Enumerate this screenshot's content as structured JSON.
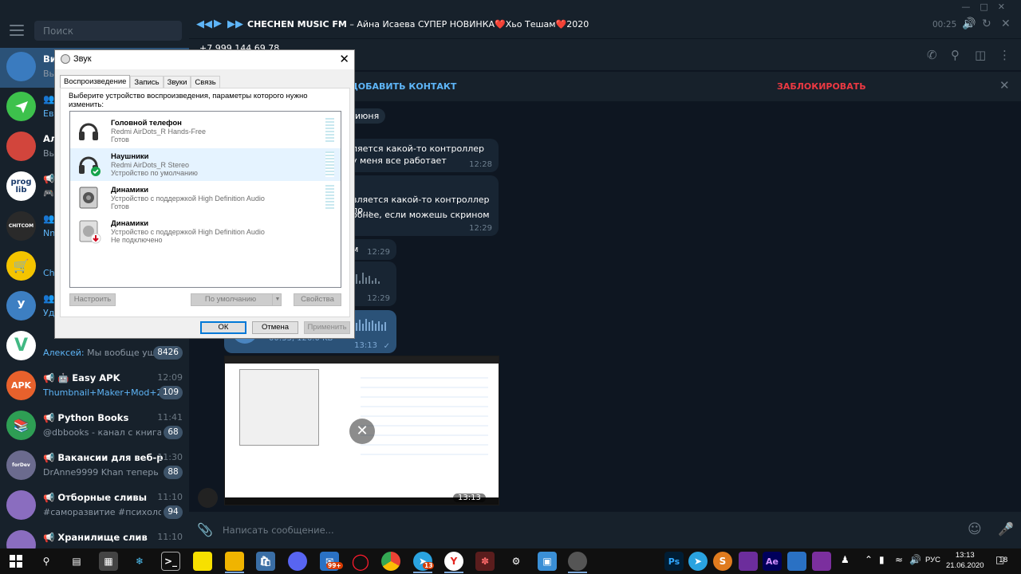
{
  "telegram": {
    "search_placeholder": "Поиск",
    "chats": [
      {
        "title": "Ви",
        "preview": "Вы",
        "avatar_color": "#3a7bbf",
        "avatar_text": ""
      },
      {
        "title": "",
        "preview": "Евг",
        "avatar_color": "#3dc14c",
        "avatar_text": ""
      },
      {
        "title": "Ал",
        "preview": "Вы",
        "avatar_color": "#d2453c",
        "avatar_text": ""
      },
      {
        "title": "",
        "preview": "",
        "avatar_color": "#ffffff",
        "avatar_text": "prog lib"
      },
      {
        "title": "",
        "preview": "Nn",
        "avatar_color": "#2a2a2a",
        "avatar_text": "CHITCOM"
      },
      {
        "title": "",
        "preview": "Cha",
        "avatar_color": "#f4c400",
        "avatar_text": ""
      },
      {
        "title": "Уд",
        "preview": "Уд",
        "avatar_color": "#3d7fc2",
        "avatar_text": "У"
      },
      {
        "title": "",
        "preview_author": "Алексей:",
        "preview": " Мы вообще ушл...",
        "badge": "8426",
        "avatar_color": "#ffffff",
        "avatar_text": "V"
      },
      {
        "title": "Easy APK",
        "time": "12:09",
        "preview": "Thumbnail+Maker+Mod+2.2-...",
        "badge": "109",
        "avatar_color": "#e8612c",
        "avatar_text": "APK"
      },
      {
        "title": "Python Books",
        "time": "11:41",
        "preview": "@dbbooks - канал с книгами ...",
        "badge": "68",
        "avatar_color": "#2e9e54",
        "avatar_text": ""
      },
      {
        "title": "Вакансии для веб-раз...",
        "time": "11:30",
        "preview": "DrAnne9999 Khan теперь в г...",
        "badge": "88",
        "avatar_color": "#6b6b8e",
        "avatar_text": "forDev"
      },
      {
        "title": "Отборные сливы",
        "time": "11:10",
        "preview": "#саморазвитие #психология...",
        "badge": "94",
        "avatar_color": "#8a6dbf",
        "avatar_text": ""
      },
      {
        "title": "Хранилище слив",
        "time": "11:10",
        "preview": "",
        "avatar_color": "#8a6dbf",
        "avatar_text": ""
      }
    ],
    "player": {
      "station": "CHECHEN MUSIC FM",
      "track": " – Айна Исаева СУПЕР НОВИНКА❤️Хьо Тешам❤️2020",
      "time": "00:25"
    },
    "contact_phone": "+7 999 144 69 78",
    "add_contact_label": "ДОБАВИТЬ КОНТАКТ",
    "block_label": "ЗАБЛОКИРОВАТЬ",
    "date_label": "июня",
    "messages": [
      {
        "line1": "ляется какой-то контроллер",
        "line2": "у меня все работает",
        "time": "12:28"
      },
      {
        "line1": "вляется какой-то контроллер по...",
        "line2": "обнее, если можешь скрином",
        "time": "12:29"
      },
      {
        "line1": "м",
        "line2": "",
        "time": "12:29"
      },
      {
        "line1": "",
        "line2": "",
        "time": "12:29"
      },
      {
        "line1": "00:33, 126.0 KB",
        "line2": "",
        "time": "13:13"
      }
    ],
    "photo_time": "13:13",
    "compose_placeholder": "Написать сообщение..."
  },
  "sound_dialog": {
    "title": "Звук",
    "tabs": [
      "Воспроизведение",
      "Запись",
      "Звуки",
      "Связь"
    ],
    "instruction": "Выберите устройство воспроизведения, параметры которого нужно изменить:",
    "devices": [
      {
        "name": "Головной телефон",
        "sub": "Redmi AirDots_R Hands-Free",
        "status": "Готов"
      },
      {
        "name": "Наушники",
        "sub": "Redmi AirDots_R Stereo",
        "status": "Устройство по умолчанию"
      },
      {
        "name": "Динамики",
        "sub": "Устройство с поддержкой High Definition Audio",
        "status": "Готов"
      },
      {
        "name": "Динамики",
        "sub": "Устройство с поддержкой High Definition Audio",
        "status": "Не подключено"
      }
    ],
    "configure_label": "Настроить",
    "default_label": "По умолчанию",
    "properties_label": "Свойства",
    "ok_label": "ОК",
    "cancel_label": "Отмена",
    "apply_label": "Применить"
  },
  "taskbar": {
    "mail_badge": "99+",
    "telegram_badge": "13",
    "language": "РУС",
    "time": "13:13",
    "date": "21.06.2020",
    "notifications": "18"
  }
}
